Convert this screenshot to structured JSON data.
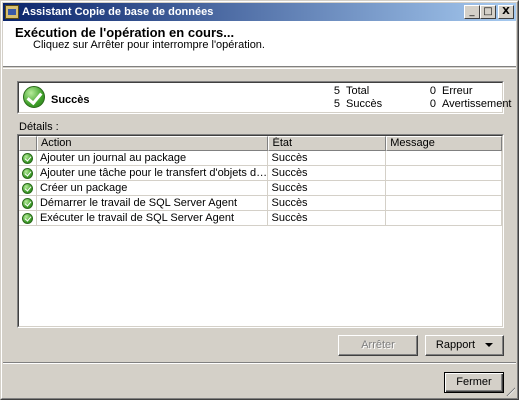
{
  "window": {
    "title": "Assistant Copie de base de données",
    "minimize_label": "_",
    "maximize_label": "□",
    "close_label": "X"
  },
  "header": {
    "title": "Exécution de l'opération en cours...",
    "subtitle": "Cliquez sur Arrêter pour interrompre l'opération."
  },
  "status": {
    "label": "Succès",
    "total_count": "5",
    "total_label": "Total",
    "success_count": "5",
    "success_label": "Succès",
    "error_count": "0",
    "error_label": "Erreur",
    "warning_count": "0",
    "warning_label": "Avertissement"
  },
  "details": {
    "label": "Détails :",
    "columns": [
      "",
      "Action",
      "État",
      "Message"
    ],
    "rows": [
      {
        "action": "Ajouter un journal au package",
        "state": "Succès",
        "message": ""
      },
      {
        "action": "Ajouter une tâche pour le transfert d'objets de base de d...",
        "state": "Succès",
        "message": ""
      },
      {
        "action": "Créer un package",
        "state": "Succès",
        "message": ""
      },
      {
        "action": "Démarrer le travail de SQL Server Agent",
        "state": "Succès",
        "message": ""
      },
      {
        "action": "Exécuter le travail de SQL Server Agent",
        "state": "Succès",
        "message": ""
      }
    ]
  },
  "buttons": {
    "stop": "Arrêter",
    "report": "Rapport",
    "close": "Fermer"
  }
}
